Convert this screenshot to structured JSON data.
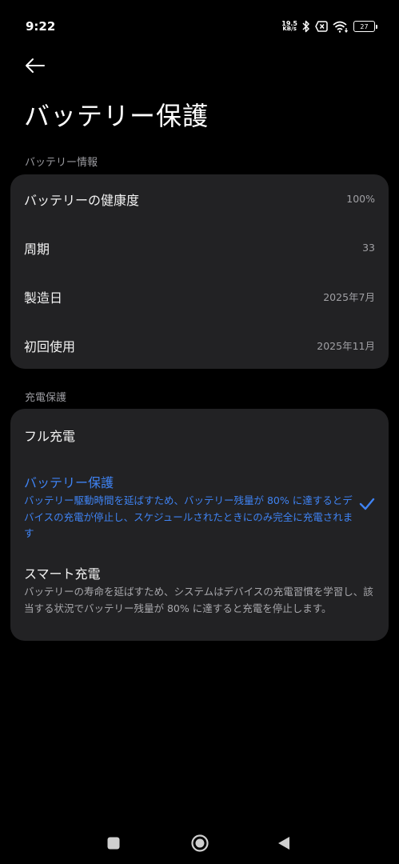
{
  "status_bar": {
    "time": "9:22",
    "net_speed_value": "19.5",
    "net_speed_unit": "KB/s",
    "battery_level": "27",
    "icons": [
      "bluetooth-icon",
      "no-sim-icon",
      "wifi-icon",
      "battery-icon"
    ]
  },
  "header": {
    "back_icon": "back-arrow-icon",
    "title": "バッテリー保護"
  },
  "battery_info": {
    "section_label": "バッテリー情報",
    "rows": [
      {
        "label": "バッテリーの健康度",
        "value": "100%"
      },
      {
        "label": "周期",
        "value": "33"
      },
      {
        "label": "製造日",
        "value": "2025年7月"
      },
      {
        "label": "初回使用",
        "value": "2025年11月"
      }
    ]
  },
  "charge_protection": {
    "section_label": "充電保護",
    "options": [
      {
        "title": "フル充電",
        "description": "",
        "selected": false
      },
      {
        "title": "バッテリー保護",
        "description": "バッテリー駆動時間を延ばすため、バッテリー残量が 80% に達するとデバイスの充電が停止し、スケジュールされたときにのみ完全に充電されます",
        "selected": true
      },
      {
        "title": "スマート充電",
        "description": "バッテリーの寿命を延ばすため、システムはデバイスの充電習慣を学習し、該当する状況でバッテリー残量が 80% に達すると充電を停止します。",
        "selected": false
      }
    ]
  },
  "colors": {
    "background": "#000000",
    "card": "#222224",
    "accent": "#3f83f3",
    "secondary_text": "#a0a0a4"
  },
  "nav_bar": {
    "icons": [
      "recents-square-icon",
      "home-circle-icon",
      "back-triangle-icon"
    ]
  }
}
